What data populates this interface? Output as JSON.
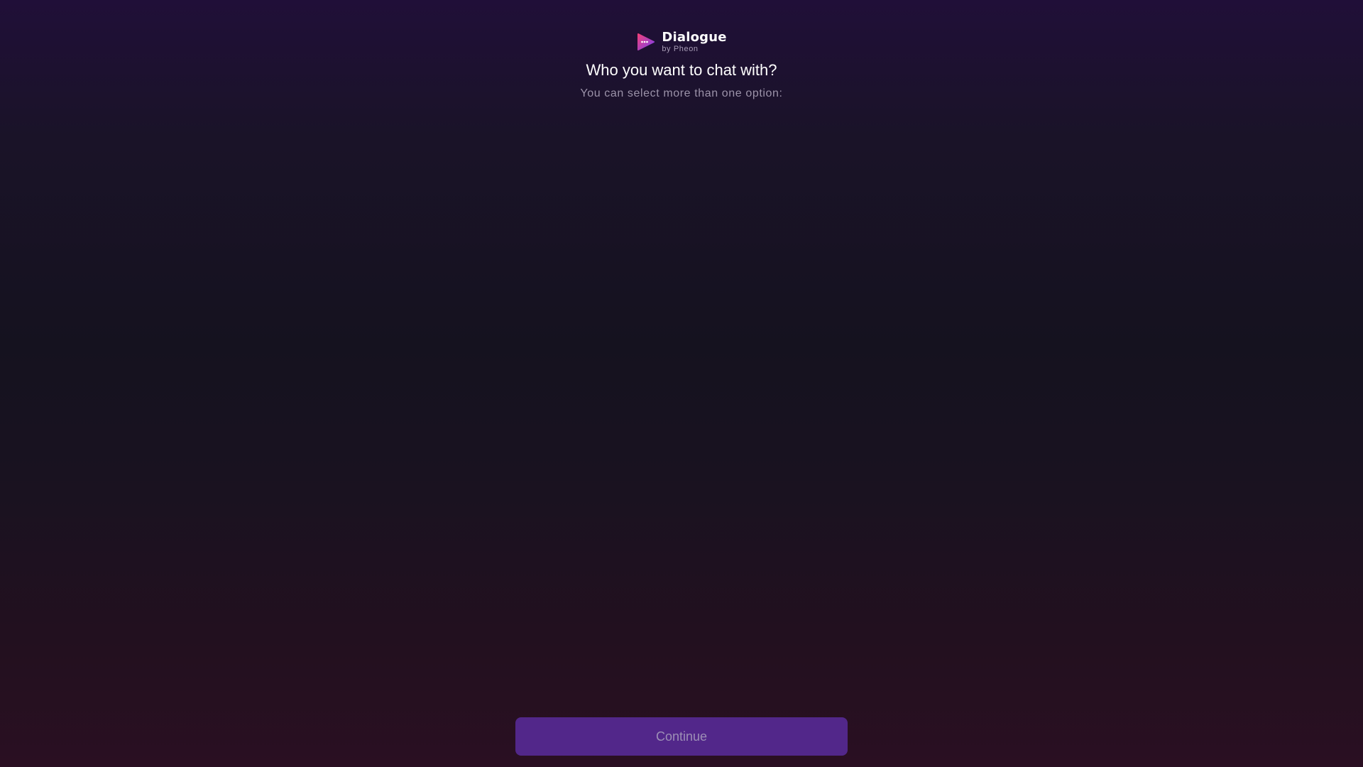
{
  "app": {
    "name": "Dialogue",
    "byline": "by Pheon",
    "logo_icon": "play-chat-icon"
  },
  "header": {
    "title": "Who you want to chat with?",
    "subtitle": "You can select more than one option:"
  },
  "footer": {
    "continue_label": "Continue"
  },
  "colors": {
    "background_top": "#200f38",
    "background_middle": "#15121f",
    "background_bottom": "#2a0f22",
    "button_background": "#52278a",
    "button_text": "#9d8fb6",
    "subtitle_text": "#9c93a9",
    "logo_gradient_start": "#e83a7a",
    "logo_gradient_end": "#7a3ff0"
  }
}
